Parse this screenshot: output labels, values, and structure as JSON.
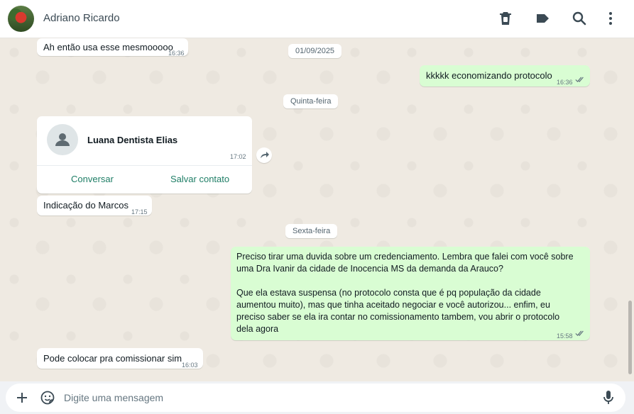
{
  "header": {
    "contact_name": "Adriano Ricardo",
    "icons": [
      "delete-icon",
      "label-icon",
      "search-icon",
      "menu-icon"
    ]
  },
  "messages": [
    {
      "text": "Ah então usa esse mesmooooo",
      "time": "16:36",
      "direction": "in"
    },
    {
      "date": "01/09/2025"
    },
    {
      "text": "kkkkk economizando protocolo",
      "time": "16:36",
      "direction": "out",
      "status": "read"
    },
    {
      "date": "Quinta-feira"
    },
    {
      "contact_card": {
        "name": "Luana Dentista Elias",
        "time": "17:02",
        "actions": [
          "Conversar",
          "Salvar contato"
        ]
      }
    },
    {
      "text": "Indicação do Marcos",
      "time": "17:15",
      "direction": "in"
    },
    {
      "date": "Sexta-feira"
    },
    {
      "text_lines": [
        "Preciso tirar uma duvida sobre um credenciamento. Lembra que falei com você sobre",
        "uma Dra Ivanir da cidade de Inocencia MS da demanda da Arauco?",
        "",
        "Que ela estava suspensa (no protocolo consta que é pq população da cidade",
        "aumentou muito), mas que tinha aceitado negociar e você autorizou... enfim, eu",
        "preciso saber se ela ira contar no comissionamento tambem, vou abrir o protocolo",
        "dela agora"
      ],
      "time": "15:58",
      "direction": "out",
      "status": "read"
    },
    {
      "text": "Pode colocar pra comissionar sim",
      "time": "16:03",
      "direction": "in"
    }
  ],
  "composer": {
    "placeholder": "Digite uma mensagem",
    "icons": [
      "plus-icon",
      "sticker-icon",
      "mic-icon"
    ]
  },
  "colors": {
    "incoming_bubble": "#ffffff",
    "outgoing_bubble": "#d9fdd3",
    "chat_background": "#efeae2",
    "accent": "#1f7e66"
  }
}
